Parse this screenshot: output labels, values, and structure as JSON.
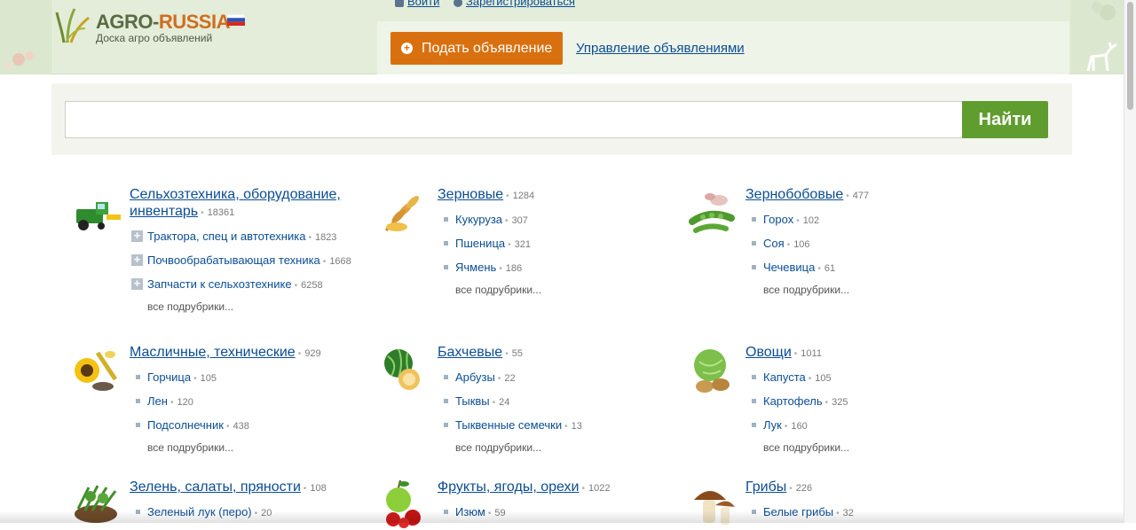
{
  "header": {
    "logo_part1": "AGRO-",
    "logo_part2": "RUSSIA",
    "logo_subtitle": "Доска агро объявлений",
    "login_label": "Войти",
    "register_label": "Зарегистрироваться",
    "post_ad_label": "Подать объявление",
    "manage_ads_label": "Управление объявлениями"
  },
  "search": {
    "value": "",
    "placeholder": "",
    "button_label": "Найти"
  },
  "colors": {
    "accent_orange": "#d9700f",
    "search_green": "#5f9d2e",
    "link_blue": "#0b4d94",
    "header_bg": "#e3edd9"
  },
  "categories": [
    {
      "icon": "harvester-icon",
      "title": "Сельхозтехника, оборудование, инвентарь",
      "count": "18361",
      "items": [
        {
          "label": "Трактора, спец и автотехника",
          "count": "1823",
          "expandable": true
        },
        {
          "label": "Почвообрабатывающая техника",
          "count": "1668",
          "expandable": true
        },
        {
          "label": "Запчасти к сельхозтехнике",
          "count": "6258",
          "expandable": true
        }
      ],
      "more": "все подрубрики..."
    },
    {
      "icon": "grain-icon",
      "title": "Зерновые",
      "count": "1284",
      "items": [
        {
          "label": "Кукуруза",
          "count": "307"
        },
        {
          "label": "Пшеница",
          "count": "321"
        },
        {
          "label": "Ячмень",
          "count": "186"
        }
      ],
      "more": "все подрубрики..."
    },
    {
      "icon": "beans-icon",
      "title": "Зернобобовые",
      "count": "477",
      "items": [
        {
          "label": "Горох",
          "count": "102"
        },
        {
          "label": "Соя",
          "count": "106"
        },
        {
          "label": "Чечевица",
          "count": "61"
        }
      ],
      "more": "все подрубрики..."
    },
    {
      "icon": "sunflower-icon",
      "title": "Масличные, технические",
      "count": "929",
      "items": [
        {
          "label": "Горчица",
          "count": "105"
        },
        {
          "label": "Лен",
          "count": "120"
        },
        {
          "label": "Подсолнечник",
          "count": "438"
        }
      ],
      "more": "все подрубрики..."
    },
    {
      "icon": "melon-icon",
      "title": "Бахчевые",
      "count": "55",
      "items": [
        {
          "label": "Арбузы",
          "count": "22"
        },
        {
          "label": "Тыквы",
          "count": "24"
        },
        {
          "label": "Тыквенные семечки",
          "count": "13"
        }
      ],
      "more": "все подрубрики..."
    },
    {
      "icon": "vegetables-icon",
      "title": "Овощи",
      "count": "1011",
      "items": [
        {
          "label": "Капуста",
          "count": "105"
        },
        {
          "label": "Картофель",
          "count": "325"
        },
        {
          "label": "Лук",
          "count": "160"
        }
      ],
      "more": "все подрубрики..."
    },
    {
      "icon": "greens-icon",
      "title": "Зелень, салаты, пряности",
      "count": "108",
      "items": [
        {
          "label": "Зеленый лук (перо)",
          "count": "20"
        }
      ]
    },
    {
      "icon": "fruits-icon",
      "title": "Фрукты, ягоды, орехи",
      "count": "1022",
      "items": [
        {
          "label": "Изюм",
          "count": "59"
        }
      ]
    },
    {
      "icon": "mushroom-icon",
      "title": "Грибы",
      "count": "226",
      "items": [
        {
          "label": "Белые грибы",
          "count": "32"
        }
      ]
    }
  ]
}
